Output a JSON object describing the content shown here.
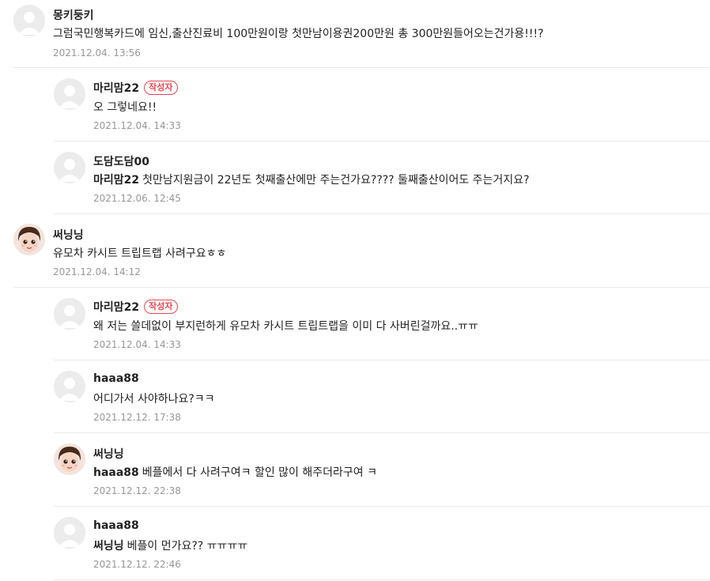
{
  "comments": [
    {
      "author": "몽키둥키",
      "text": "그럼국민행복카드에 임신,출산진료비 100만원이랑 첫만남이용권200만원 총 300만원들어오는건가용!!!?",
      "date": "2021.12.04. 13:56"
    },
    {
      "author": "마리맘22",
      "badge": "작성자",
      "text": "오 그렇네요!!",
      "date": "2021.12.04. 14:33"
    },
    {
      "author": "도담도담00",
      "mention": "마리맘22",
      "text": "첫만남지원금이 22년도 첫째출산에만 주는건가요???? 둘째출산이어도 주는거지요?",
      "date": "2021.12.06. 12:45"
    },
    {
      "author": "써닝닝",
      "text": "유모차 카시트 트립트랩 사려구요ㅎㅎ",
      "date": "2021.12.04. 14:12"
    },
    {
      "author": "마리맘22",
      "badge": "작성자",
      "text": "왜 저는 쓸데없이 부지런하게 유모차 카시트 트립트랩을 이미 다 사버린걸까요..ㅠㅠ",
      "date": "2021.12.04. 14:33"
    },
    {
      "author": "haaa88",
      "text": "어디가서 사야하나요?ㅋㅋ",
      "date": "2021.12.12. 17:38"
    },
    {
      "author": "써닝닝",
      "mention": "haaa88",
      "text": "베플에서 다 사려구여ㅋ 할인 많이 해주더라구여 ㅋ",
      "date": "2021.12.12. 22:38"
    },
    {
      "author": "haaa88",
      "mention": "써닝닝",
      "text": "베플이 먼가요?? ㅠㅠㅠㅠ",
      "date": "2021.12.12. 22:46"
    }
  ]
}
